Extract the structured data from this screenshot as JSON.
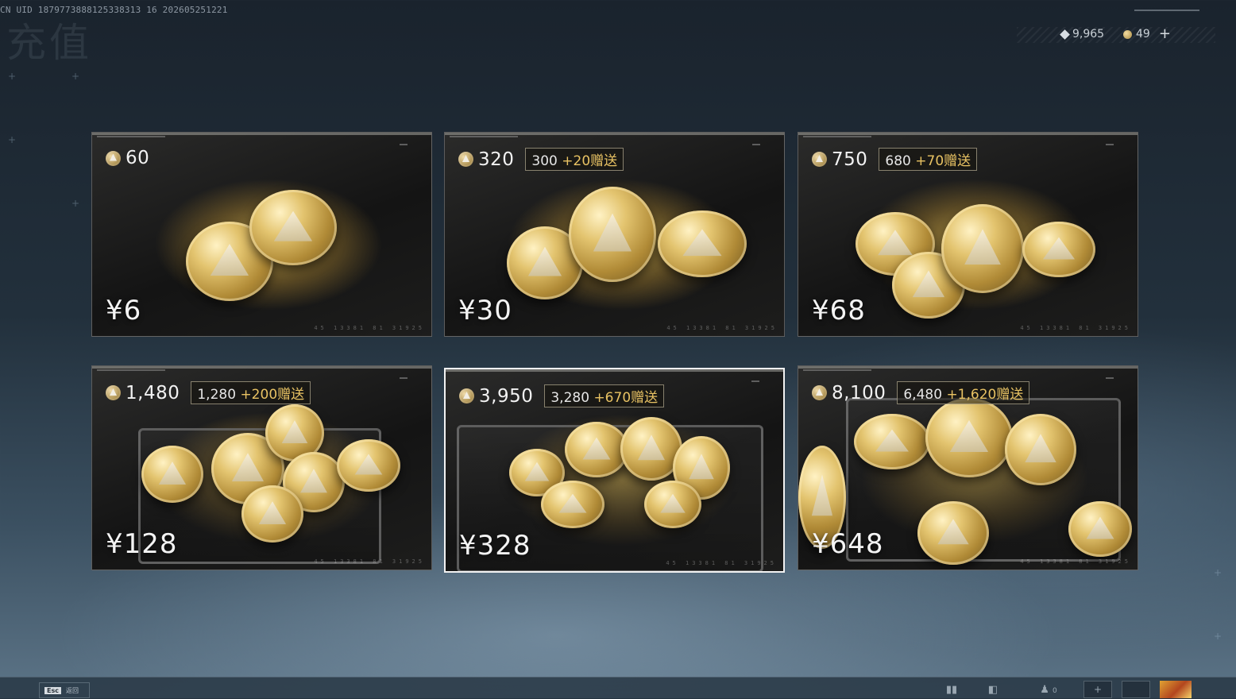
{
  "header": {
    "uid_text": "CN UID 1879773888125338313 16 202605251221",
    "watermark_title": "充值"
  },
  "currencies": {
    "ticket": {
      "icon": "diamond-ticket-icon",
      "value": "9,965"
    },
    "coin": {
      "icon": "delta-coin-icon",
      "value": "49",
      "add_label": "+"
    }
  },
  "packages": [
    {
      "amount": "60",
      "bonus_base": "",
      "bonus_gift": "",
      "price": "¥6"
    },
    {
      "amount": "320",
      "bonus_base": "300 ",
      "bonus_gift": "+20赠送",
      "price": "¥30"
    },
    {
      "amount": "750",
      "bonus_base": "680 ",
      "bonus_gift": "+70赠送",
      "price": "¥68"
    },
    {
      "amount": "1,480",
      "bonus_base": "1,280 ",
      "bonus_gift": "+200赠送",
      "price": "¥128"
    },
    {
      "amount": "3,950",
      "bonus_base": "3,280 ",
      "bonus_gift": "+670赠送",
      "price": "¥328"
    },
    {
      "amount": "8,100",
      "bonus_base": "6,480 ",
      "bonus_gift": "+1,620赠送",
      "price": "¥648"
    }
  ],
  "selected_package_index": 4,
  "bottom_bar": {
    "esc_key": "Esc",
    "esc_label": "返回",
    "icons": [
      "stats-icon",
      "chat-bubbles-icon",
      "friends-icon"
    ],
    "friends_count": "0"
  },
  "colors": {
    "gift_text": "#e8c263",
    "selected_border": "#f2f2f2"
  }
}
